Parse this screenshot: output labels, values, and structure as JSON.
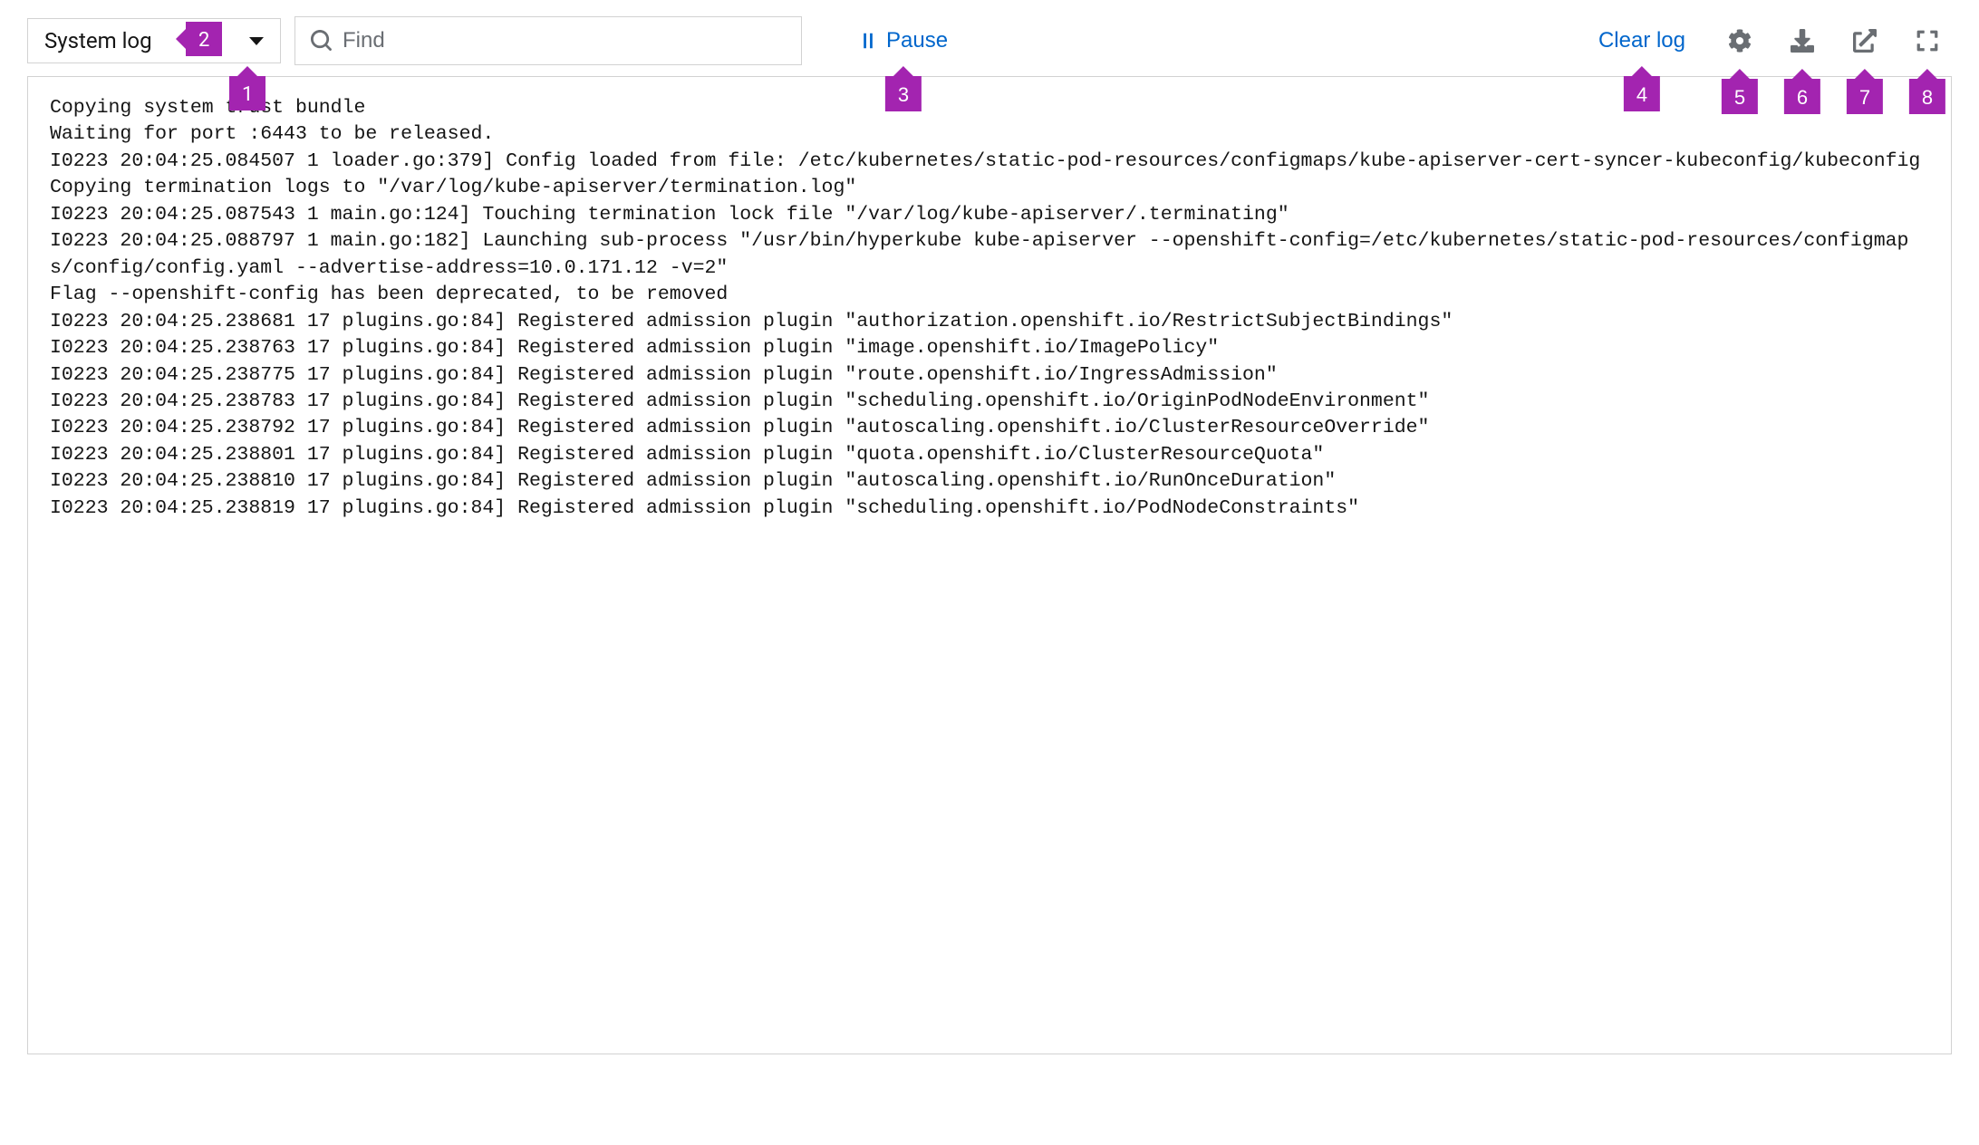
{
  "toolbar": {
    "dropdown_label": "System log",
    "search_placeholder": "Find",
    "pause_label": "Pause",
    "clear_label": "Clear log"
  },
  "callouts": {
    "c1": "1",
    "c2": "2",
    "c3": "3",
    "c4": "4",
    "c5": "5",
    "c6": "6",
    "c7": "7",
    "c8": "8"
  },
  "log_lines": [
    "Copying system trust bundle",
    "Waiting for port :6443 to be released.",
    "I0223 20:04:25.084507 1 loader.go:379] Config loaded from file: /etc/kubernetes/static-pod-resources/configmaps/kube-apiserver-cert-syncer-kubeconfig/kubeconfig",
    "Copying termination logs to \"/var/log/kube-apiserver/termination.log\"",
    "I0223 20:04:25.087543 1 main.go:124] Touching termination lock file \"/var/log/kube-apiserver/.terminating\"",
    "I0223 20:04:25.088797 1 main.go:182] Launching sub-process \"/usr/bin/hyperkube kube-apiserver --openshift-config=/etc/kubernetes/static-pod-resources/configmaps/config/config.yaml --advertise-address=10.0.171.12 -v=2\"",
    "Flag --openshift-config has been deprecated, to be removed",
    "I0223 20:04:25.238681 17 plugins.go:84] Registered admission plugin \"authorization.openshift.io/RestrictSubjectBindings\"",
    "I0223 20:04:25.238763 17 plugins.go:84] Registered admission plugin \"image.openshift.io/ImagePolicy\"",
    "I0223 20:04:25.238775 17 plugins.go:84] Registered admission plugin \"route.openshift.io/IngressAdmission\"",
    "I0223 20:04:25.238783 17 plugins.go:84] Registered admission plugin \"scheduling.openshift.io/OriginPodNodeEnvironment\"",
    "I0223 20:04:25.238792 17 plugins.go:84] Registered admission plugin \"autoscaling.openshift.io/ClusterResourceOverride\"",
    "I0223 20:04:25.238801 17 plugins.go:84] Registered admission plugin \"quota.openshift.io/ClusterResourceQuota\"",
    "I0223 20:04:25.238810 17 plugins.go:84] Registered admission plugin \"autoscaling.openshift.io/RunOnceDuration\"",
    "I0223 20:04:25.238819 17 plugins.go:84] Registered admission plugin \"scheduling.openshift.io/PodNodeConstraints\""
  ]
}
